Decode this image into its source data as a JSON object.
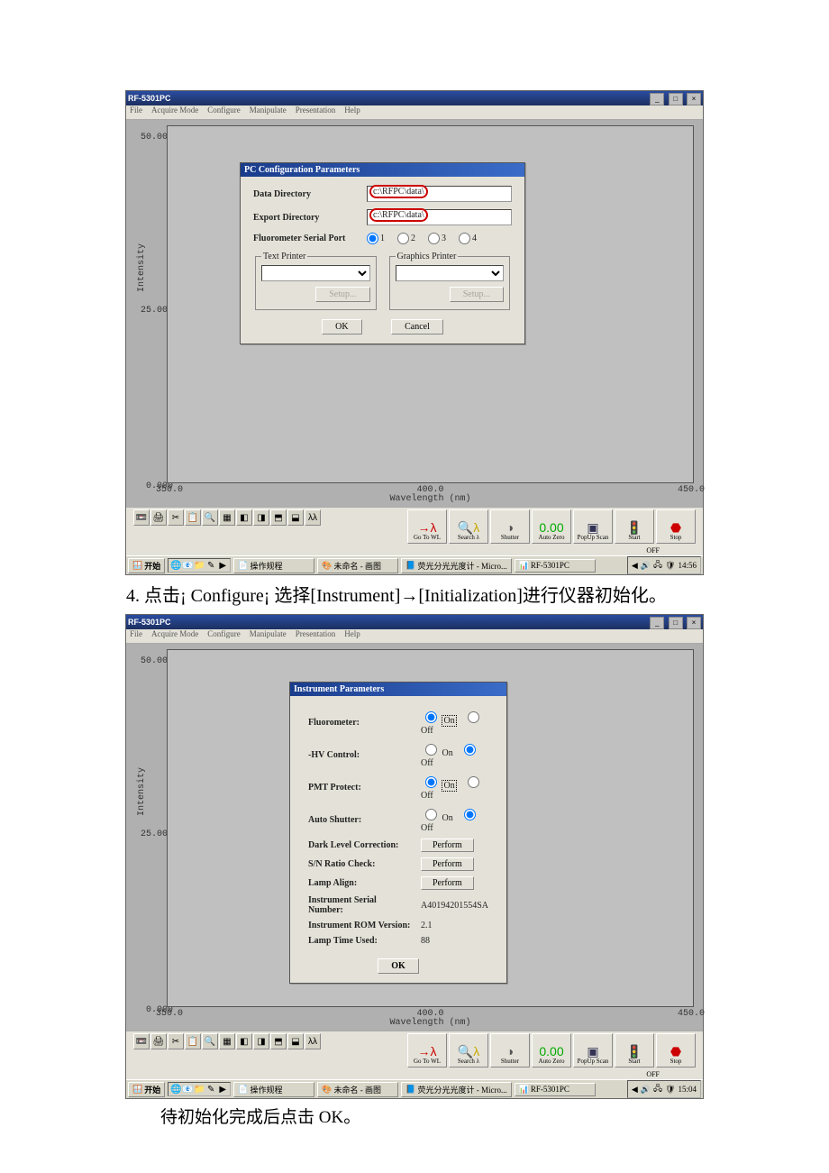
{
  "app_title": "RF-5301PC",
  "menus": [
    "File",
    "Acquire Mode",
    "Configure",
    "Manipulate",
    "Presentation",
    "Help"
  ],
  "plot": {
    "ylabel": "Intensity",
    "xlabel": "Wavelength (nm)",
    "yticks": [
      "50.000",
      "25.000",
      "0.000"
    ],
    "xticks": [
      "350.0",
      "400.0",
      "450.0"
    ]
  },
  "dlg1": {
    "title": "PC Configuration Parameters",
    "data_dir_label": "Data Directory",
    "data_dir_value": "c:\\RFPC\\data\\",
    "export_dir_label": "Export Directory",
    "export_dir_value": "c:\\RFPC\\data\\",
    "serial_label": "Fluorometer Serial Port",
    "serial_opts": [
      "1",
      "2",
      "3",
      "4"
    ],
    "serial_sel": "1",
    "text_printer": "Text Printer",
    "graphics_printer": "Graphics Printer",
    "setup": "Setup...",
    "ok": "OK",
    "cancel": "Cancel"
  },
  "bigbtns": [
    {
      "name": "gotowl",
      "icon": "→λ",
      "label": "Go To WL",
      "color": "#c00"
    },
    {
      "name": "searchl",
      "icon": "🔍λ",
      "label": "Search λ",
      "color": "#c7a800"
    },
    {
      "name": "shutter",
      "icon": "◑",
      "label": "Shutter",
      "color": "#555"
    },
    {
      "name": "autozero",
      "icon": "0.00",
      "label": "Auto Zero",
      "color": "#0a0"
    },
    {
      "name": "popup",
      "icon": "▣",
      "label": "PopUp Scan",
      "color": "#335"
    },
    {
      "name": "start",
      "icon": "🚦",
      "label": "Start",
      "color": "#0a0"
    },
    {
      "name": "stop",
      "icon": "⬣",
      "label": "Stop",
      "color": "#c00"
    }
  ],
  "off_label": "OFF",
  "taskbar": {
    "start": "开始",
    "items": [
      "操作规程",
      "未命名 - 画图",
      "荧光分光光度计 - Micro...",
      "RF-5301PC"
    ],
    "time1": "14:56",
    "time2": "15:04"
  },
  "step4": "4.  点击¡ Configure¡ 选择[Instrument]→[Initialization]进行仪器初始化。",
  "dlg2": {
    "title": "Instrument Parameters",
    "rows": [
      {
        "l": "Fluorometer:",
        "type": "radio",
        "sel": "On"
      },
      {
        "l": "-HV Control:",
        "type": "radio",
        "sel": "Off"
      },
      {
        "l": "PMT Protect:",
        "type": "radio",
        "sel": "On"
      },
      {
        "l": "Auto Shutter:",
        "type": "radio",
        "sel": "Off"
      },
      {
        "l": "Dark Level Correction:",
        "type": "perform"
      },
      {
        "l": "S/N Ratio Check:",
        "type": "perform"
      },
      {
        "l": "Lamp Align:",
        "type": "perform"
      },
      {
        "l": "Instrument Serial Number:",
        "type": "text",
        "v": "A40194201554SA"
      },
      {
        "l": "Instrument ROM Version:",
        "type": "text",
        "v": "2.1"
      },
      {
        "l": "Lamp Time Used:",
        "type": "text",
        "v": "88"
      }
    ],
    "on": "On",
    "off": "Off",
    "perform": "Perform",
    "ok": "OK"
  },
  "caption2": "待初始化完成后点击 OK。"
}
